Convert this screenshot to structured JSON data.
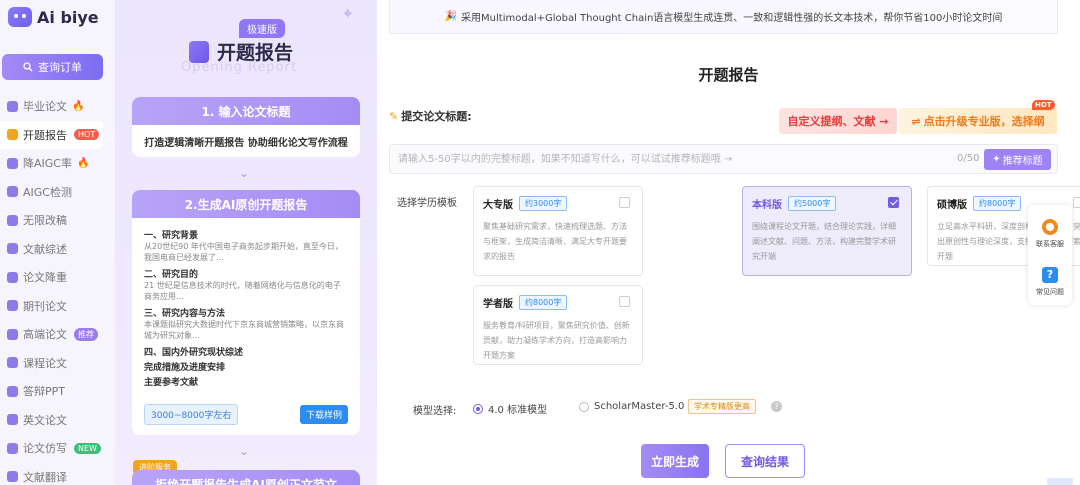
{
  "app": {
    "name": "Ai biye"
  },
  "sidebar": {
    "search_order_label": "查询订单",
    "items": [
      {
        "label": "毕业论文",
        "badge": "",
        "flame": true
      },
      {
        "label": "开题报告",
        "badge": "HOT",
        "flame": false
      },
      {
        "label": "降AIGC率",
        "badge": "",
        "flame": true
      },
      {
        "label": "AIGC检测",
        "badge": "",
        "flame": false
      },
      {
        "label": "无限改稿",
        "badge": "",
        "flame": false
      },
      {
        "label": "文献综述",
        "badge": "",
        "flame": false
      },
      {
        "label": "论文降重",
        "badge": "",
        "flame": false
      },
      {
        "label": "期刊论文",
        "badge": "",
        "flame": false
      },
      {
        "label": "高端论文",
        "badge": "推荐",
        "flame": false
      },
      {
        "label": "课程论文",
        "badge": "",
        "flame": false
      },
      {
        "label": "答辩PPT",
        "badge": "",
        "flame": false
      },
      {
        "label": "英文论文",
        "badge": "",
        "flame": false
      },
      {
        "label": "论文仿写",
        "badge": "NEW",
        "flame": false
      },
      {
        "label": "文献翻译",
        "badge": "",
        "flame": false
      }
    ]
  },
  "preview": {
    "speed_tag": "极速版",
    "title": "开题报告",
    "subtitle": "Opening Report",
    "step1_title": "1. 输入论文标题",
    "step1_body": "打造逻辑清晰开题报告 协助细化论文写作流程",
    "step2_title": "2.生成AI原创开题报告",
    "outline": [
      {
        "head": "一、研究背景",
        "body": "从20世纪90 年代中国电子商务起步期开始，直至今日，我国电商已经发展了…"
      },
      {
        "head": "二、研究目的",
        "body": "21 世纪是信息技术的时代，随着网络化与信息化的电子商务应用…"
      },
      {
        "head": "三、研究内容与方法",
        "body": "本课题拟研究大数据时代下京东商城营销策略，以京东商城为研究对象…"
      },
      {
        "head": "四、国内外研究现状综述",
        "body": ""
      },
      {
        "head": "完成措施及进度安排",
        "body": ""
      },
      {
        "head": "主要参考文献",
        "body": ""
      }
    ],
    "range_label": "3000~8000字左右",
    "sample_button": "下载样例",
    "advanced_tag": "进阶服务",
    "step3_title": "拒绝开题报告生成AI原创正文范文"
  },
  "main": {
    "notice": "采用Multimodal+Global Thought Chain语言模型生成连贯、一致和逻辑性强的长文本技术，帮你节省100小时论文时间",
    "title": "开题报告",
    "submit_label": "提交论文标题:",
    "custom_button": "自定义提纲、文献 →",
    "upgrade_button": "点击升级专业版，选择纲",
    "upgrade_hot": "HOT",
    "title_input": {
      "value": "",
      "placeholder": "请输入5-50字以内的完整标题，如果不知道写什么，可以试试推荐标题哦 →"
    },
    "counter": "0/50",
    "recommend_button": "推荐标题",
    "edu_label": "选择学历模板",
    "options": [
      {
        "name": "大专版",
        "words": "约3000字",
        "checked": false,
        "desc": "聚焦基础研究需求，快速梳理选题、方法与框架，生成简洁清晰、满足大专开题要求的报告"
      },
      {
        "name": "本科版",
        "words": "约5000字",
        "checked": true,
        "desc": "围绕课程论文开题，结合理论实践，详细阐述文献、问题、方法，构建完整学术研究开端"
      },
      {
        "name": "硕博版",
        "words": "约8000字",
        "checked": false,
        "desc": "立足高水平科研，深度剖析创新路径，突出原创性与理论深度，支撑前沿学术探索开题"
      },
      {
        "name": "学者版",
        "words": "约8000字",
        "checked": false,
        "desc": "服务教育/科研项目，聚焦研究价值、创新贡献，助力凝练学术方向，打造高影响力开题方案"
      }
    ],
    "model_label": "模型选择:",
    "models": [
      {
        "label": "4.0 标准模型",
        "selected": true
      },
      {
        "label": "ScholarMaster-5.0",
        "selected": false
      }
    ],
    "model_tag": "学术专精版更高",
    "generate_button": "立即生成",
    "query_button": "查询结果"
  },
  "float_bar": {
    "service_label": "联系客服",
    "help_label": "常见问题"
  },
  "colors": {
    "accent": "#8e78f3",
    "hot": "#ff5a4c",
    "orange": "#f07a1a",
    "blue": "#2d8cf0"
  }
}
